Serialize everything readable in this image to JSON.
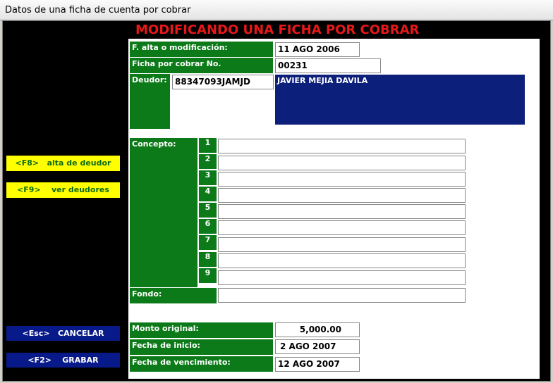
{
  "window": {
    "title": "Datos de una ficha de cuenta por cobrar"
  },
  "heading": "MODIFICANDO UNA FICHA POR COBRAR",
  "fields": {
    "alta_label": "F. alta o modificación:",
    "alta_value": "11 AGO 2006",
    "ficha_label": "Ficha por cobrar No.",
    "ficha_value": "00231",
    "deudor_label": "Deudor:",
    "deudor_rfc": "88347093JAMJD",
    "deudor_nombre": "JAVIER MEJIA DAVILA",
    "concepto_label": "Concepto:",
    "concepto_lines": [
      "1",
      "2",
      "3",
      "4",
      "5",
      "6",
      "7",
      "8",
      "9"
    ],
    "fondo_label": "Fondo:",
    "monto_label": "Monto original:",
    "monto_value": "5,000.00",
    "inicio_label": "Fecha de inicio:",
    "inicio_value": "2 AGO 2007",
    "venc_label": "Fecha de vencimiento:",
    "venc_value": "12 AGO 2007"
  },
  "side_buttons": {
    "f8": "<F8>   alta de deudor",
    "f9": "<F9>    ver deudores",
    "esc": "<Esc>   CANCELAR",
    "f2": "<F2>    GRABAR"
  },
  "colors": {
    "heading": "#e81818",
    "label_bg": "#0c7a18",
    "fkey_bg": "#ffff00",
    "action_bg": "#081a8a",
    "name_bg": "#0c1f7a"
  }
}
